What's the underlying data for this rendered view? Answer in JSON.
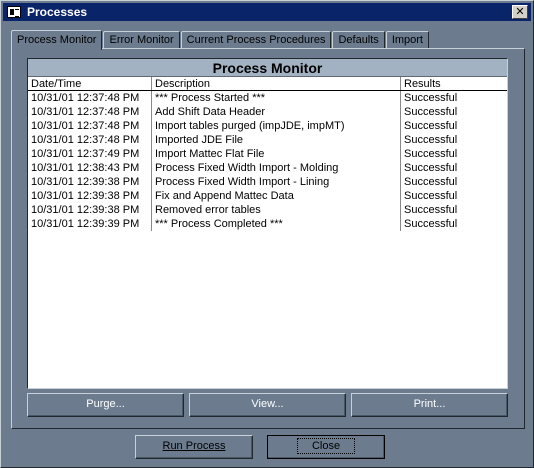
{
  "window": {
    "title": "Processes",
    "close_glyph": "✕"
  },
  "tabs": [
    {
      "label": "Process Monitor"
    },
    {
      "label": "Error Monitor"
    },
    {
      "label": "Current Process Procedures"
    },
    {
      "label": "Defaults"
    },
    {
      "label": "Import"
    }
  ],
  "grid": {
    "title": "Process Monitor",
    "columns": [
      "Date/Time",
      "Description",
      "Results"
    ],
    "rows": [
      [
        "10/31/01 12:37:48 PM",
        "*** Process Started ***",
        "Successful"
      ],
      [
        "10/31/01 12:37:48 PM",
        "Add Shift Data Header",
        "Successful"
      ],
      [
        "10/31/01 12:37:48 PM",
        "Import tables purged (impJDE, impMT)",
        "Successful"
      ],
      [
        "10/31/01 12:37:48 PM",
        "Imported JDE File",
        "Successful"
      ],
      [
        "10/31/01 12:37:49 PM",
        "Import Mattec Flat File",
        "Successful"
      ],
      [
        "10/31/01 12:38:43 PM",
        "Process Fixed Width Import - Molding",
        "Successful"
      ],
      [
        "10/31/01 12:39:38 PM",
        "Process Fixed Width Import - Lining",
        "Successful"
      ],
      [
        "10/31/01 12:39:38 PM",
        "Fix and Append Mattec Data",
        "Successful"
      ],
      [
        "10/31/01 12:39:38 PM",
        "Removed error tables",
        "Successful"
      ],
      [
        "10/31/01 12:39:39 PM",
        "*** Process Completed ***",
        "Successful"
      ]
    ]
  },
  "panel_buttons": {
    "purge": "Purge...",
    "view": "View...",
    "print": "Print..."
  },
  "footer_buttons": {
    "run": "Run Process",
    "close": "Close"
  }
}
